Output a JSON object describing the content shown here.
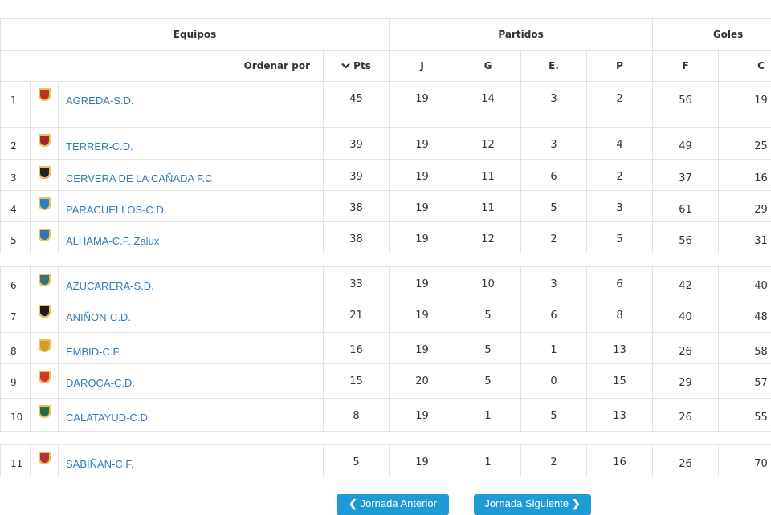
{
  "header": {
    "equipos": "Equipos",
    "partidos": "Partidos",
    "goles": "Goles",
    "ordenar_por": "Ordenar por",
    "pts": "Pts",
    "j": "J",
    "g": "G",
    "e": "E.",
    "p": "P",
    "f": "F",
    "c": "C"
  },
  "icons": {
    "sort": "chevron-down-icon",
    "prev": "chevron-left-icon",
    "next": "chevron-right-icon",
    "team": "team-shield-icon"
  },
  "rows": [
    {
      "pos": "1",
      "team": "AGREDA-S.D.",
      "pts": "45",
      "j": "19",
      "g": "14",
      "e": "3",
      "p": "2",
      "f": "56",
      "c": "19",
      "color": "#b8322a"
    },
    {
      "pos": "2",
      "team": "TERRER-C.D.",
      "pts": "39",
      "j": "19",
      "g": "12",
      "e": "3",
      "p": "4",
      "f": "49",
      "c": "25",
      "color": "#a0282e"
    },
    {
      "pos": "3",
      "team": "CERVERA DE LA CAÑADA F.C.",
      "pts": "39",
      "j": "19",
      "g": "11",
      "e": "6",
      "p": "2",
      "f": "37",
      "c": "16",
      "color": "#222222"
    },
    {
      "pos": "4",
      "team": "PARACUELLOS-C.D.",
      "pts": "38",
      "j": "19",
      "g": "11",
      "e": "5",
      "p": "3",
      "f": "61",
      "c": "29",
      "color": "#2e7fc1"
    },
    {
      "pos": "5",
      "team": "ALHAMA-C.F. Zalux",
      "pts": "38",
      "j": "19",
      "g": "12",
      "e": "2",
      "p": "5",
      "f": "56",
      "c": "31",
      "color": "#3a6fb0"
    },
    {
      "pos": "6",
      "team": "AZUCARERA-S.D.",
      "pts": "33",
      "j": "19",
      "g": "10",
      "e": "3",
      "p": "6",
      "f": "42",
      "c": "40",
      "color": "#3d6f7a"
    },
    {
      "pos": "7",
      "team": "ANIÑON-C.D.",
      "pts": "21",
      "j": "19",
      "g": "5",
      "e": "6",
      "p": "8",
      "f": "40",
      "c": "48",
      "color": "#1a1a1a"
    },
    {
      "pos": "8",
      "team": "EMBID-C.F.",
      "pts": "16",
      "j": "19",
      "g": "5",
      "e": "1",
      "p": "13",
      "f": "26",
      "c": "58",
      "color": "#d49a2a"
    },
    {
      "pos": "9",
      "team": "DAROCA-C.D.",
      "pts": "15",
      "j": "20",
      "g": "5",
      "e": "0",
      "p": "15",
      "f": "29",
      "c": "57",
      "color": "#d4372a"
    },
    {
      "pos": "10",
      "team": "CALATAYUD-C.D.",
      "pts": "8",
      "j": "19",
      "g": "1",
      "e": "5",
      "p": "13",
      "f": "26",
      "c": "55",
      "color": "#2f6b3a"
    },
    {
      "pos": "11",
      "team": "SABIÑAN-C.F.",
      "pts": "5",
      "j": "19",
      "g": "1",
      "e": "2",
      "p": "16",
      "f": "26",
      "c": "70",
      "color": "#b03040"
    }
  ],
  "buttons": {
    "prev": "Jornada Anterior",
    "next": "Jornada Siguiente"
  }
}
